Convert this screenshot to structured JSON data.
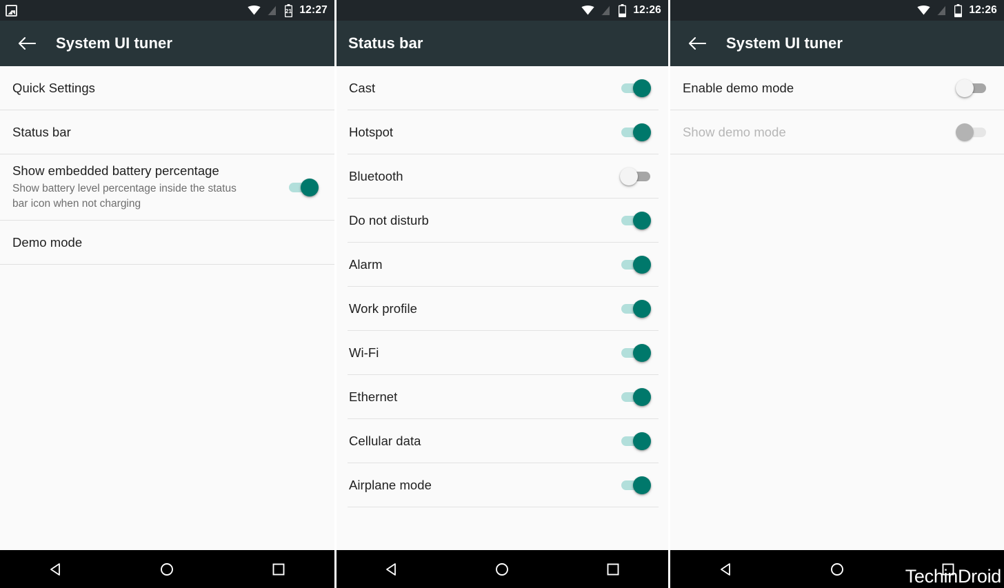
{
  "panels": [
    {
      "id": "system-ui-tuner-main",
      "statusbar": {
        "time": "12:27",
        "icons": [
          "image-icon",
          "wifi-icon",
          "signal-off-icon",
          "battery-21-icon"
        ],
        "battery_text": "21"
      },
      "appbar": {
        "has_back": true,
        "title": "System UI tuner"
      },
      "rows": [
        {
          "title": "Quick Settings",
          "subtitle": "",
          "control": "none"
        },
        {
          "title": "Status bar",
          "subtitle": "",
          "control": "none"
        },
        {
          "title": "Show embedded battery percentage",
          "subtitle": "Show battery level percentage inside the status bar icon when not charging",
          "control": "switch",
          "state": "on"
        },
        {
          "title": "Demo mode",
          "subtitle": "",
          "control": "none"
        }
      ],
      "navbar": {
        "back": "back-nav-icon",
        "home": "home-nav-icon",
        "recents": "recents-nav-icon"
      },
      "watermark": ""
    },
    {
      "id": "status-bar-settings",
      "statusbar": {
        "time": "12:26",
        "icons": [
          "wifi-icon",
          "signal-off-icon",
          "battery-icon"
        ],
        "battery_text": ""
      },
      "appbar": {
        "has_back": false,
        "title": "Status bar"
      },
      "rows": [
        {
          "title": "Cast",
          "subtitle": "",
          "control": "switch",
          "state": "on"
        },
        {
          "title": "Hotspot",
          "subtitle": "",
          "control": "switch",
          "state": "on"
        },
        {
          "title": "Bluetooth",
          "subtitle": "",
          "control": "switch",
          "state": "off"
        },
        {
          "title": "Do not disturb",
          "subtitle": "",
          "control": "switch",
          "state": "on"
        },
        {
          "title": "Alarm",
          "subtitle": "",
          "control": "switch",
          "state": "on"
        },
        {
          "title": "Work profile",
          "subtitle": "",
          "control": "switch",
          "state": "on"
        },
        {
          "title": "Wi-Fi",
          "subtitle": "",
          "control": "switch",
          "state": "on"
        },
        {
          "title": "Ethernet",
          "subtitle": "",
          "control": "switch",
          "state": "on"
        },
        {
          "title": "Cellular data",
          "subtitle": "",
          "control": "switch",
          "state": "on"
        },
        {
          "title": "Airplane mode",
          "subtitle": "",
          "control": "switch",
          "state": "on"
        }
      ],
      "navbar": {
        "back": "back-nav-icon",
        "home": "home-nav-icon",
        "recents": "recents-nav-icon"
      },
      "watermark": ""
    },
    {
      "id": "demo-mode-settings",
      "statusbar": {
        "time": "12:26",
        "icons": [
          "wifi-icon",
          "signal-off-icon",
          "battery-icon"
        ],
        "battery_text": ""
      },
      "appbar": {
        "has_back": true,
        "title": "System UI tuner"
      },
      "rows": [
        {
          "title": "Enable demo mode",
          "subtitle": "",
          "control": "switch",
          "state": "off"
        },
        {
          "title": "Show demo mode",
          "subtitle": "",
          "control": "switch",
          "state": "disabled"
        }
      ],
      "navbar": {
        "back": "back-nav-icon",
        "home": "home-nav-icon",
        "recents": "recents-nav-icon"
      },
      "watermark": "TechinDroid"
    }
  ],
  "colors": {
    "statusbar_bg": "#20262a",
    "appbar_bg": "#283539",
    "list_bg": "#fafafa",
    "switch_on_thumb": "#00786b",
    "switch_on_track": "#b2dfdb",
    "switch_off_thumb": "#f4f4f4",
    "switch_off_track": "#a6a6a6",
    "navbar_bg": "#000000",
    "title_text": "#1f1f1f",
    "sub_text": "#6e6e6e",
    "disabled_text": "#b6b6b6"
  }
}
